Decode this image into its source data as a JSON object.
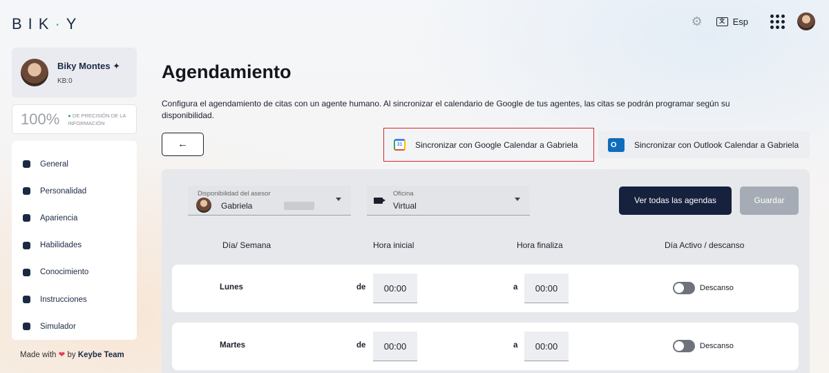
{
  "brand": {
    "logo_left": "BIK",
    "logo_dot": "·",
    "logo_right": "Y"
  },
  "topbar": {
    "language": "Esp"
  },
  "profile": {
    "name": "Biky Montes ✦",
    "kb": "KB:0"
  },
  "precision": {
    "value": "100%",
    "label": "DE PRECISIÓN DE LA INFORMACIÓN"
  },
  "sidebar": {
    "items": [
      {
        "label": "General",
        "icon": "clipboard-icon"
      },
      {
        "label": "Personalidad",
        "icon": "masks-icon"
      },
      {
        "label": "Apariencia",
        "icon": "glasses-icon"
      },
      {
        "label": "Habilidades",
        "icon": "gear-badge-icon"
      },
      {
        "label": "Conocimiento",
        "icon": "brain-icon"
      },
      {
        "label": "Instrucciones",
        "icon": "route-icon"
      },
      {
        "label": "Simulador",
        "icon": "chat-icon"
      }
    ]
  },
  "footer": {
    "made_with": "Made with",
    "by": "by",
    "team": "Keybe Team"
  },
  "page": {
    "title": "Agendamiento",
    "description": "Configura el agendamiento de citas con un agente humano. Al sincronizar el calendario de Google de tus agentes, las citas se podrán programar según su disponibilidad.",
    "back_label": "←",
    "sync_google": "Sincronizar con Google Calendar a Gabriela",
    "sync_outlook": "Sincronizar con Outlook Calendar a Gabriela"
  },
  "filters": {
    "advisor_label": "Disponibilidad del asesor",
    "advisor_value": "Gabriela",
    "office_label": "Oficina",
    "office_value": "Virtual"
  },
  "actions": {
    "view_all": "Ver todas las agendas",
    "save": "Guardar"
  },
  "table": {
    "headers": [
      "Día/ Semana",
      "Hora inicial",
      "Hora finaliza",
      "Día Activo / descanso"
    ],
    "rows": [
      {
        "day": "Lunes",
        "from_label": "de",
        "start": "00:00",
        "to_label": "a",
        "end": "00:00",
        "status": "Descanso"
      },
      {
        "day": "Martes",
        "from_label": "de",
        "start": "00:00",
        "to_label": "a",
        "end": "00:00",
        "status": "Descanso"
      }
    ]
  }
}
